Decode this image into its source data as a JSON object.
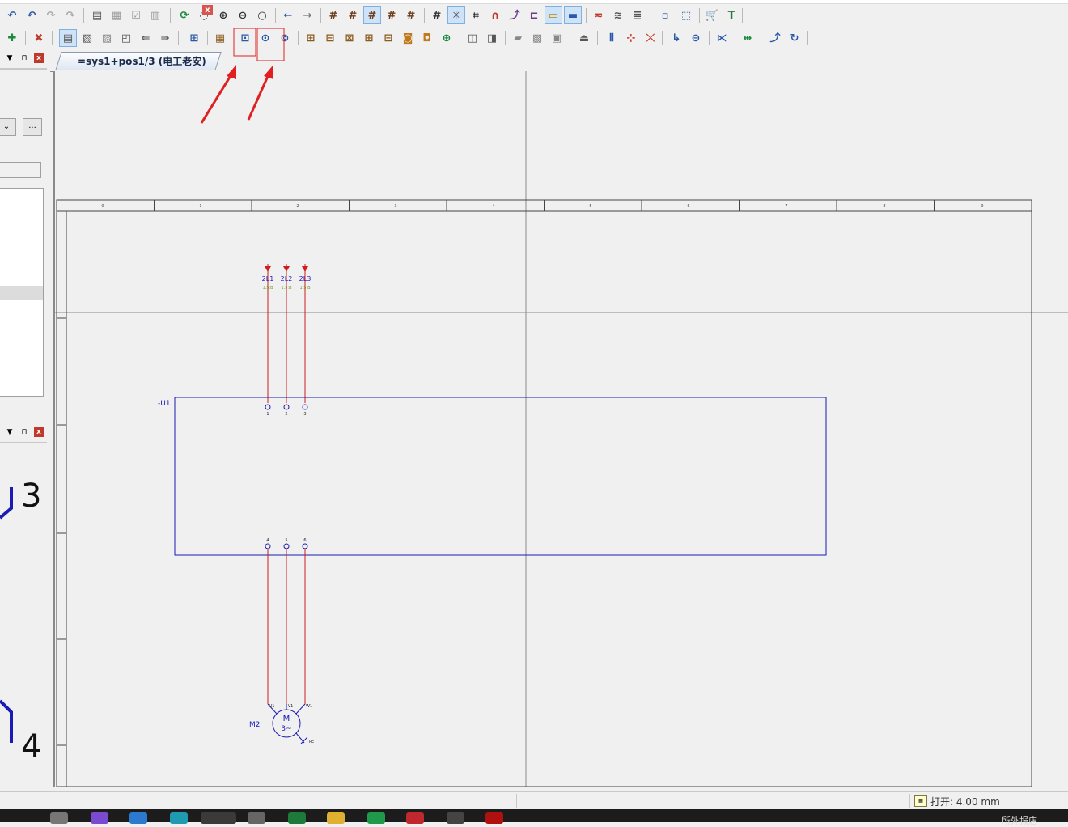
{
  "document_tab": {
    "label": "=sys1+pos1/3 (电工老安)",
    "close_label": "x"
  },
  "status_bar": {
    "text": "打开: 4.00 mm",
    "grid_icon": "grid-size-icon"
  },
  "taskbar": {
    "tray_text": "所外报店"
  },
  "left_panel": {
    "top_pane": {
      "pin": "⊓",
      "close": "x",
      "dropdown_label": "",
      "more_button": "..."
    },
    "bottom_pane": {
      "pin": "⊓",
      "close": "x",
      "preview_numbers": [
        "3",
        "4"
      ]
    }
  },
  "toolbar_row1": [
    "undo-icon",
    "undo-back-icon",
    "redo-icon",
    "redo-forward-icon",
    "page-layout-icon",
    "page-layout2-icon",
    "page-check-icon",
    "page-table-icon",
    "refresh-icon",
    "zoom-window-icon",
    "zoom-in-icon",
    "zoom-out-icon",
    "zoom-100-icon",
    "nav-back-icon",
    "nav-forward-icon",
    "grid-a-icon",
    "grid-b-icon",
    "grid-c-icon",
    "grid-d-icon",
    "grid-e-icon",
    "grid-toggle-icon",
    "snap-icon",
    "crosshair-icon",
    "magnet-icon",
    "jump-icon",
    "link-icon",
    "tag-icon",
    "ruler-icon",
    "wire-icon",
    "wire2-icon",
    "wire3-icon",
    "fit-icon",
    "select-frame-icon",
    "cart-icon",
    "text-icon"
  ],
  "toolbar_row2_highlighted": [
    "macro-insert-icon",
    "macro-place-icon"
  ],
  "schematic": {
    "column_numbers": [
      "0",
      "1",
      "2",
      "3",
      "4",
      "5",
      "6",
      "7",
      "8",
      "9"
    ],
    "supply_terminals": [
      {
        "label": "2L1",
        "ref": "1.5:B"
      },
      {
        "label": "2L2",
        "ref": "1.5:B"
      },
      {
        "label": "2L3",
        "ref": "1.5:B"
      }
    ],
    "device_label": "-U1",
    "device_top_pins": [
      "1",
      "2",
      "3"
    ],
    "device_bottom_pins": [
      "4",
      "5",
      "6"
    ],
    "motor": {
      "label": "M2",
      "symbol_top": "M",
      "symbol_bottom": "3~",
      "pins": [
        "U1",
        "V1",
        "W1"
      ],
      "pe_label": "PE"
    }
  },
  "colors": {
    "wire": "#d01c1c",
    "device": "#1a1ab4",
    "grid": "#8a8a8a",
    "annotation": "#e02020",
    "ref_text": "#6b9b2a"
  }
}
